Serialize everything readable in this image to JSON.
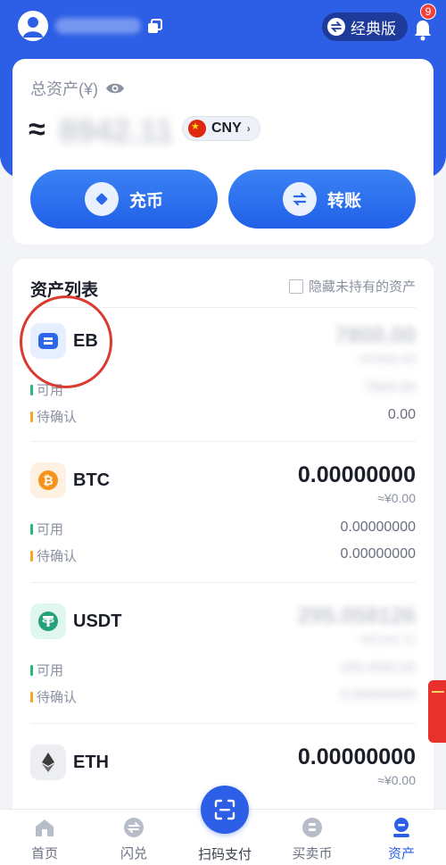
{
  "header": {
    "uid_masked": "",
    "classic_label": "经典版",
    "notification_count": "9"
  },
  "assets": {
    "total_label": "总资产(¥)",
    "approx_symbol": "≈",
    "total_value": "8942.11",
    "currency": "CNY",
    "deposit_label": "充币",
    "transfer_label": "转账"
  },
  "list": {
    "title": "资产列表",
    "hide_option": "隐藏未持有的资产",
    "available_label": "可用",
    "pending_label": "待确认",
    "coins": [
      {
        "symbol": "EB",
        "amount": "7800.00",
        "fiat": "≈¥7800.00",
        "available": "7800.00",
        "pending": "0.00",
        "icon": "eb-icon",
        "blurred": true
      },
      {
        "symbol": "BTC",
        "amount": "0.00000000",
        "fiat": "≈¥0.00",
        "available": "0.00000000",
        "pending": "0.00000000",
        "icon": "bitcoin-icon",
        "blurred": false
      },
      {
        "symbol": "USDT",
        "amount": "295.058126",
        "fiat": "≈¥2142.11",
        "available": "295.058126",
        "pending": "0.00000000",
        "icon": "tether-icon",
        "blurred": true
      },
      {
        "symbol": "ETH",
        "amount": "0.00000000",
        "fiat": "≈¥0.00",
        "icon": "ethereum-icon",
        "blurred": false
      }
    ]
  },
  "tabs": {
    "home": "首页",
    "swap": "闪兑",
    "scan_pay": "扫码支付",
    "trade": "买卖币",
    "assets": "资产"
  },
  "colors": {
    "brand": "#2c5fe6",
    "available_bar": "#27b87a",
    "pending_bar": "#f5a623",
    "badge": "#f2413a"
  }
}
